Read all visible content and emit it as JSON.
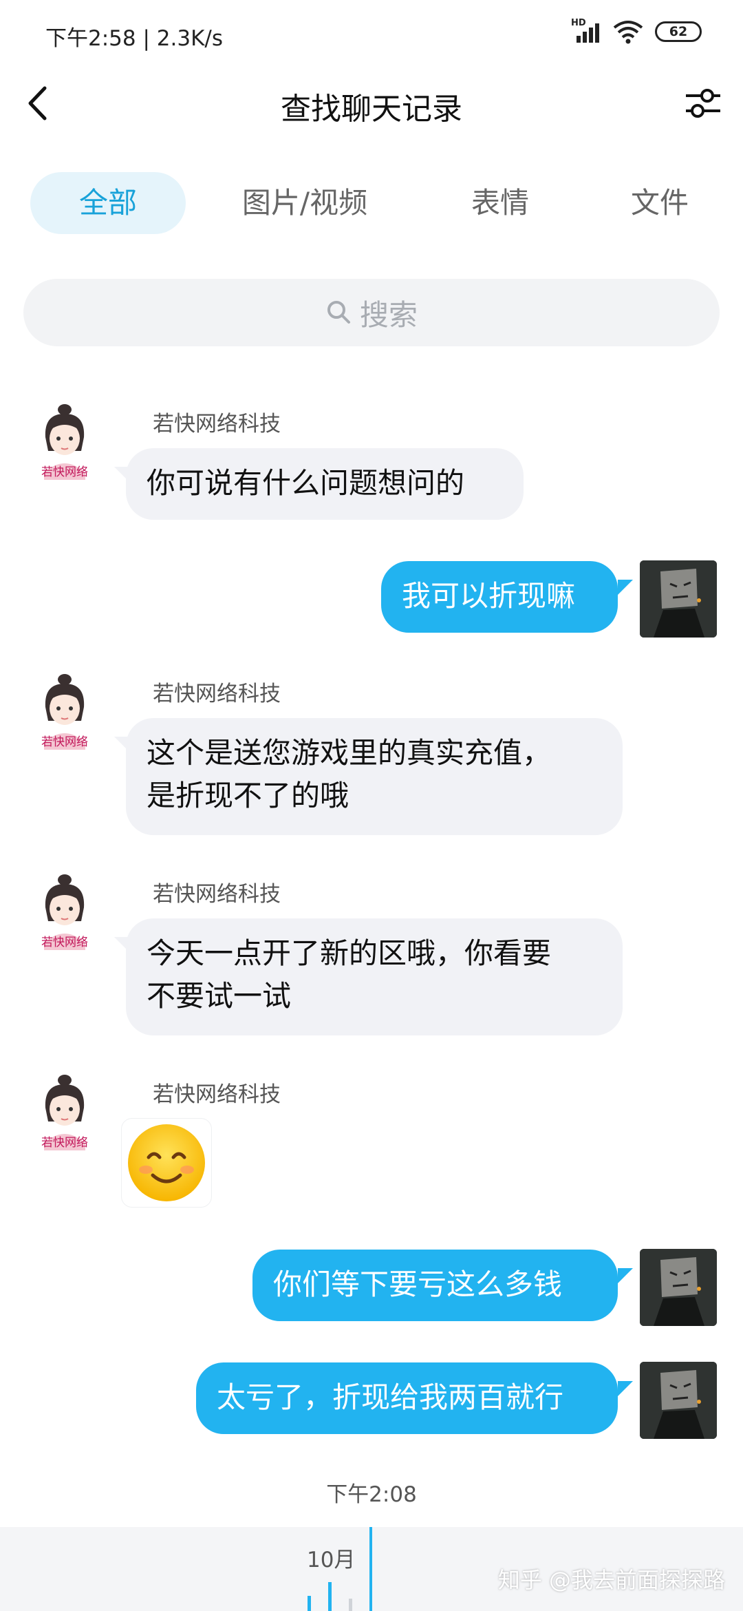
{
  "status_bar": {
    "time_speed": "下午2:58 | 2.3K/s",
    "hd_label": "HD",
    "battery": "62"
  },
  "nav": {
    "title": "查找聊天记录"
  },
  "tabs": [
    {
      "label": "全部",
      "active": true
    },
    {
      "label": "图片/视频",
      "active": false
    },
    {
      "label": "表情",
      "active": false
    },
    {
      "label": "文件",
      "active": false
    }
  ],
  "search": {
    "placeholder": "搜索"
  },
  "messages": [
    {
      "from": "other",
      "sender": "若快网络科技",
      "avatar_label": "若快网络",
      "text": "你可说有什么问题想问的"
    },
    {
      "from": "me",
      "text": "我可以折现嘛"
    },
    {
      "from": "other",
      "sender": "若快网络科技",
      "avatar_label": "若快网络",
      "text_lines": [
        "这个是送您游戏里的真实充值，",
        "是折现不了的哦"
      ]
    },
    {
      "from": "other",
      "sender": "若快网络科技",
      "avatar_label": "若快网络",
      "text_lines": [
        "今天一点开了新的区哦，你看要",
        "不要试一试"
      ]
    },
    {
      "from": "other",
      "sender": "若快网络科技",
      "avatar_label": "若快网络",
      "sticker": "smiling-face-emoji"
    },
    {
      "from": "me",
      "text": "你们等下要亏这么多钱"
    },
    {
      "from": "me",
      "text": "太亏了，折现给我两百就行"
    }
  ],
  "time_label": "下午2:08",
  "timeline": {
    "month": "10月"
  },
  "watermark": "知乎 @我去前面探探路",
  "colors": {
    "accent": "#22b3f0",
    "tab_active_bg": "#e5f4fb",
    "tab_active_text": "#18a2d9",
    "bubble_in": "#f1f2f6"
  }
}
